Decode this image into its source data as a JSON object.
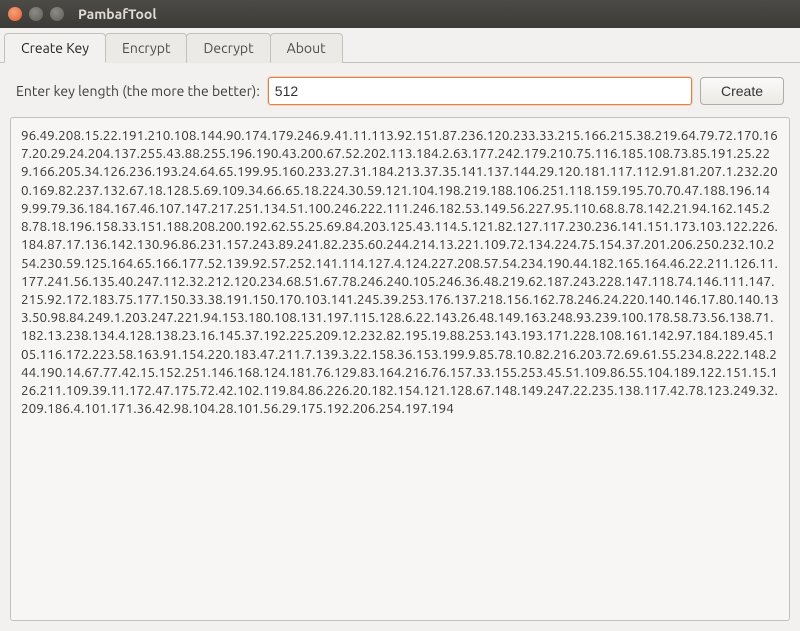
{
  "window": {
    "title": "PambafTool"
  },
  "tabs": {
    "items": [
      {
        "label": "Create Key",
        "active": true
      },
      {
        "label": "Encrypt",
        "active": false
      },
      {
        "label": "Decrypt",
        "active": false
      },
      {
        "label": "About",
        "active": false
      }
    ]
  },
  "form": {
    "label": "Enter key length (the more the better):",
    "value": "512",
    "button": "Create"
  },
  "output": "96.49.208.15.22.191.210.108.144.90.174.179.246.9.41.11.113.92.151.87.236.120.233.33.215.166.215.38.219.64.79.72.170.167.20.29.24.204.137.255.43.88.255.196.190.43.200.67.52.202.113.184.2.63.177.242.179.210.75.116.185.108.73.85.191.25.229.166.205.34.126.236.193.24.64.65.199.95.160.233.27.31.184.213.37.35.141.137.144.29.120.181.117.112.91.81.207.1.232.200.169.82.237.132.67.18.128.5.69.109.34.66.65.18.224.30.59.121.104.198.219.188.106.251.118.159.195.70.70.47.188.196.149.99.79.36.184.167.46.107.147.217.251.134.51.100.246.222.111.246.182.53.149.56.227.95.110.68.8.78.142.21.94.162.145.28.78.18.196.158.33.151.188.208.200.192.62.55.25.69.84.203.125.43.114.5.121.82.127.117.230.236.141.151.173.103.122.226.184.87.17.136.142.130.96.86.231.157.243.89.241.82.235.60.244.214.13.221.109.72.134.224.75.154.37.201.206.250.232.10.254.230.59.125.164.65.166.177.52.139.92.57.252.141.114.127.4.124.227.208.57.54.234.190.44.182.165.164.46.22.211.126.11.177.241.56.135.40.247.112.32.212.120.234.68.51.67.78.246.240.105.246.36.48.219.62.187.243.228.147.118.74.146.111.147.215.92.172.183.75.177.150.33.38.191.150.170.103.141.245.39.253.176.137.218.156.162.78.246.24.220.140.146.17.80.140.133.50.98.84.249.1.203.247.221.94.153.180.108.131.197.115.128.6.22.143.26.48.149.163.248.93.239.100.178.58.73.56.138.71.182.13.238.134.4.128.138.23.16.145.37.192.225.209.12.232.82.195.19.88.253.143.193.171.228.108.161.142.97.184.189.45.105.116.172.223.58.163.91.154.220.183.47.211.7.139.3.22.158.36.153.199.9.85.78.10.82.216.203.72.69.61.55.234.8.222.148.244.190.14.67.77.42.15.152.251.146.168.124.181.76.129.83.164.216.76.157.33.155.253.45.51.109.86.55.104.189.122.151.15.126.211.109.39.11.172.47.175.72.42.102.119.84.86.226.20.182.154.121.128.67.148.149.247.22.235.138.117.42.78.123.249.32.209.186.4.101.171.36.42.98.104.28.101.56.29.175.192.206.254.197.194"
}
